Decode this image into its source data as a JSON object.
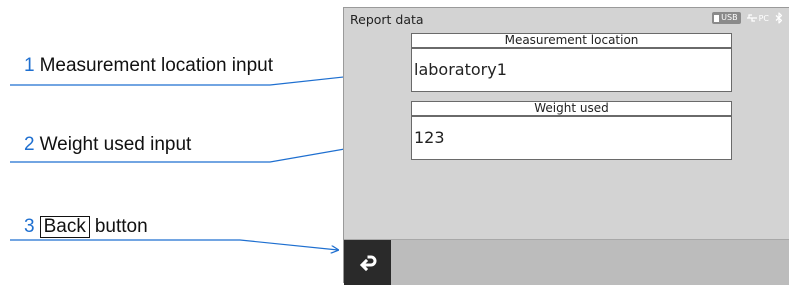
{
  "annotations": [
    {
      "number": "1",
      "text": "Measurement location input"
    },
    {
      "number": "2",
      "text": "Weight used input"
    },
    {
      "number": "3",
      "button_label": "Back",
      "text": "button"
    }
  ],
  "screen": {
    "title": "Report data",
    "status": {
      "usb_label": "USB",
      "pc_label": "PC",
      "icons": [
        "usb-icon",
        "pc-connection-icon",
        "bluetooth-icon"
      ]
    },
    "fields": {
      "location": {
        "label": "Measurement location",
        "value": "laboratory1"
      },
      "weight": {
        "label": "Weight used",
        "value": "123"
      }
    },
    "bottom_bar": {
      "back_icon": "return-arrow-icon"
    }
  },
  "colors": {
    "annotation_number": "#1e6fd0",
    "leader_line": "#1e6fd0",
    "screen_background": "#d3d3d3",
    "back_button": "#2a2a2a"
  }
}
